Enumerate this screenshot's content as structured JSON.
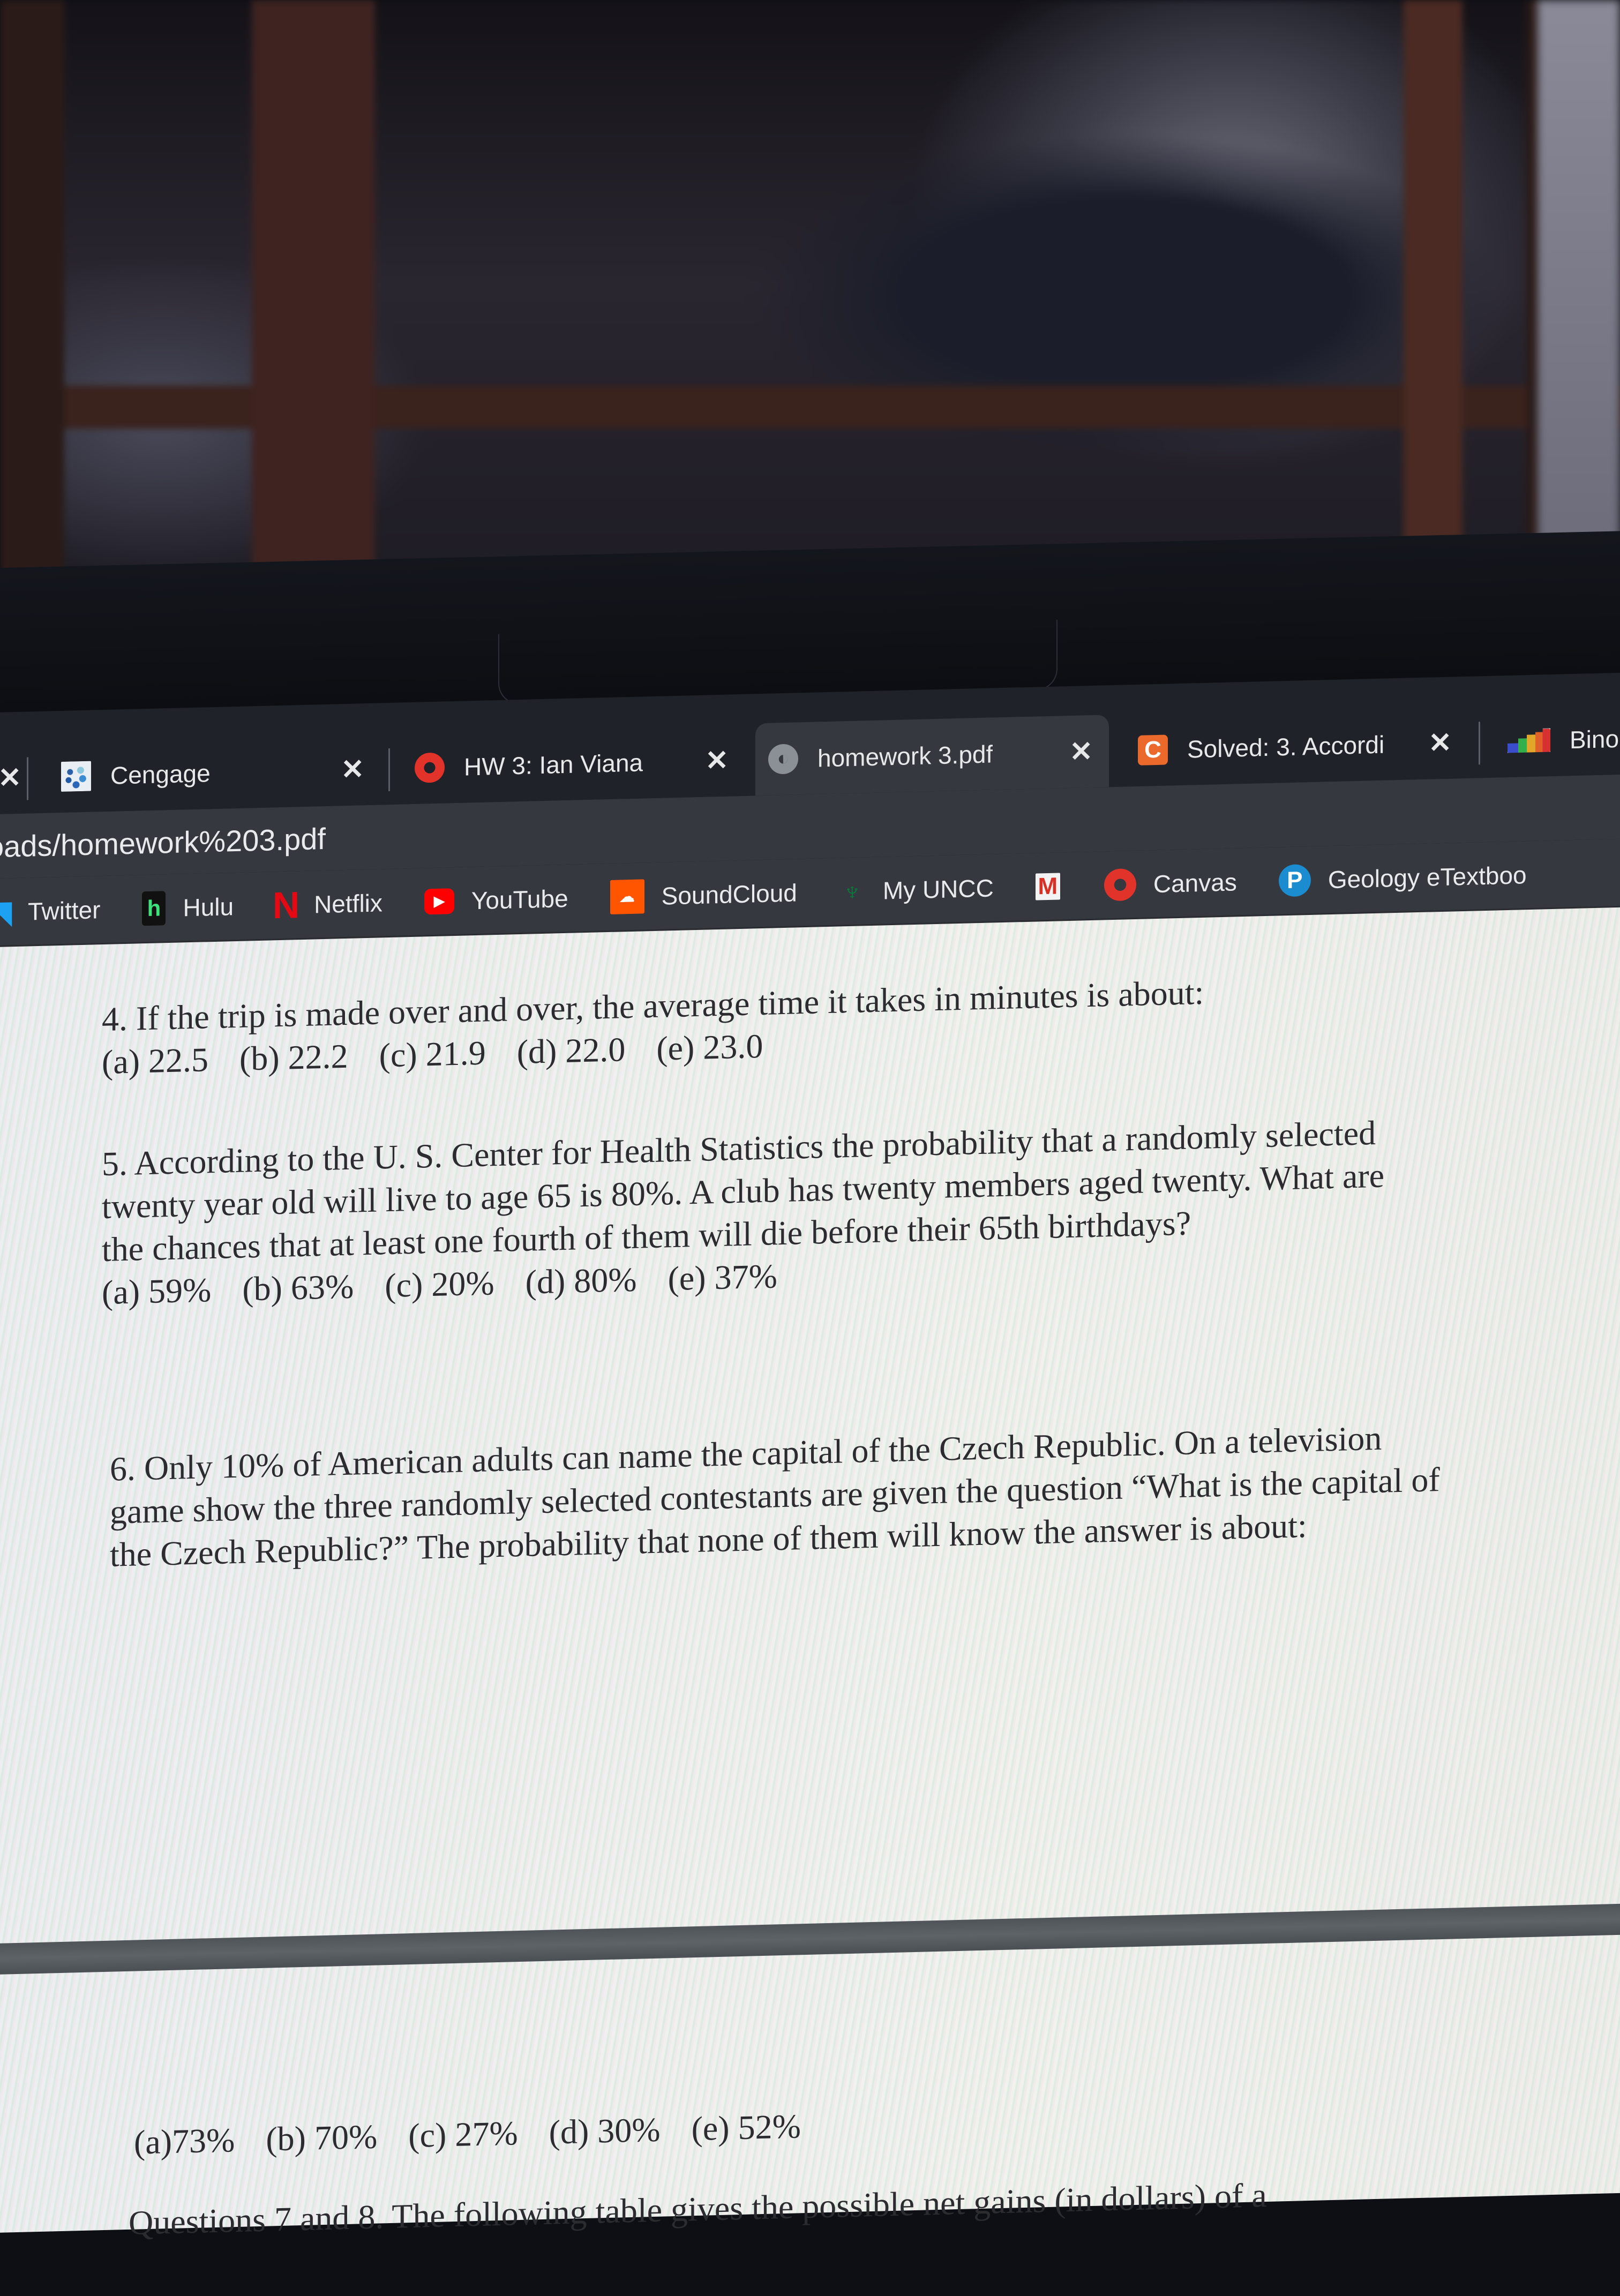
{
  "browser": {
    "tabs": [
      {
        "label": "",
        "icon": "close-icon",
        "partial": true
      },
      {
        "label": "Cengage",
        "icon": "cengage-favicon",
        "active": false
      },
      {
        "label": "HW 3: Ian Viana",
        "icon": "canvas-favicon",
        "active": false
      },
      {
        "label": "homework 3.pdf",
        "icon": "globe-favicon",
        "active": true
      },
      {
        "label": "Solved: 3. Accordi",
        "icon": "chegg-favicon",
        "active": false
      },
      {
        "label": "Bino",
        "icon": "binomial-chart-favicon",
        "active": false
      }
    ],
    "close_glyph": "✕",
    "url": "oads/homework%203.pdf",
    "bookmarks": [
      {
        "label": "Twitter",
        "icon": "twitter-icon",
        "glyph": "🐦"
      },
      {
        "label": "Hulu",
        "icon": "hulu-icon",
        "glyph": "h"
      },
      {
        "label": "Netflix",
        "icon": "netflix-icon",
        "glyph": "N"
      },
      {
        "label": "YouTube",
        "icon": "youtube-icon",
        "glyph": "▶"
      },
      {
        "label": "SoundCloud",
        "icon": "soundcloud-icon",
        "glyph": "☁"
      },
      {
        "label": "My UNCC",
        "icon": "uncc-icon",
        "glyph": "♆"
      },
      {
        "label": "",
        "icon": "gmail-icon",
        "glyph": "M"
      },
      {
        "label": "Canvas",
        "icon": "canvas-icon",
        "glyph": ""
      },
      {
        "label": "Geology eTextboo",
        "icon": "pearson-icon",
        "glyph": "P"
      }
    ]
  },
  "document": {
    "q4": {
      "text": "4. If the trip is made over and over, the average time it takes in minutes is about:",
      "choices": [
        "(a) 22.5",
        "(b) 22.2",
        "(c) 21.9",
        "(d) 22.0",
        "(e) 23.0"
      ]
    },
    "q5": {
      "lines": [
        "5. According to the U. S. Center for Health Statistics the probability that a randomly selected",
        "twenty year old will live to age 65 is 80%. A club has twenty members aged twenty. What are",
        "the chances that at least one fourth of them will die before their 65th birthdays?"
      ],
      "choices": [
        "(a) 59%",
        "(b) 63%",
        "(c) 20%",
        "(d) 80%",
        "(e) 37%"
      ]
    },
    "q6": {
      "lines": [
        "6. Only 10% of American adults can name the capital of the Czech Republic. On a television",
        "game show the three randomly selected contestants are given the question “What is the capital of",
        "the Czech Republic?” The probability that none of them will know the answer is about:"
      ],
      "choices": [
        "(a)73%",
        "(b) 70%",
        "(c) 27%",
        "(d) 30%",
        "(e) 52%"
      ]
    },
    "q7_8_intro": "Questions 7 and 8. The following table gives the possible net gains (in dollars) of a"
  }
}
